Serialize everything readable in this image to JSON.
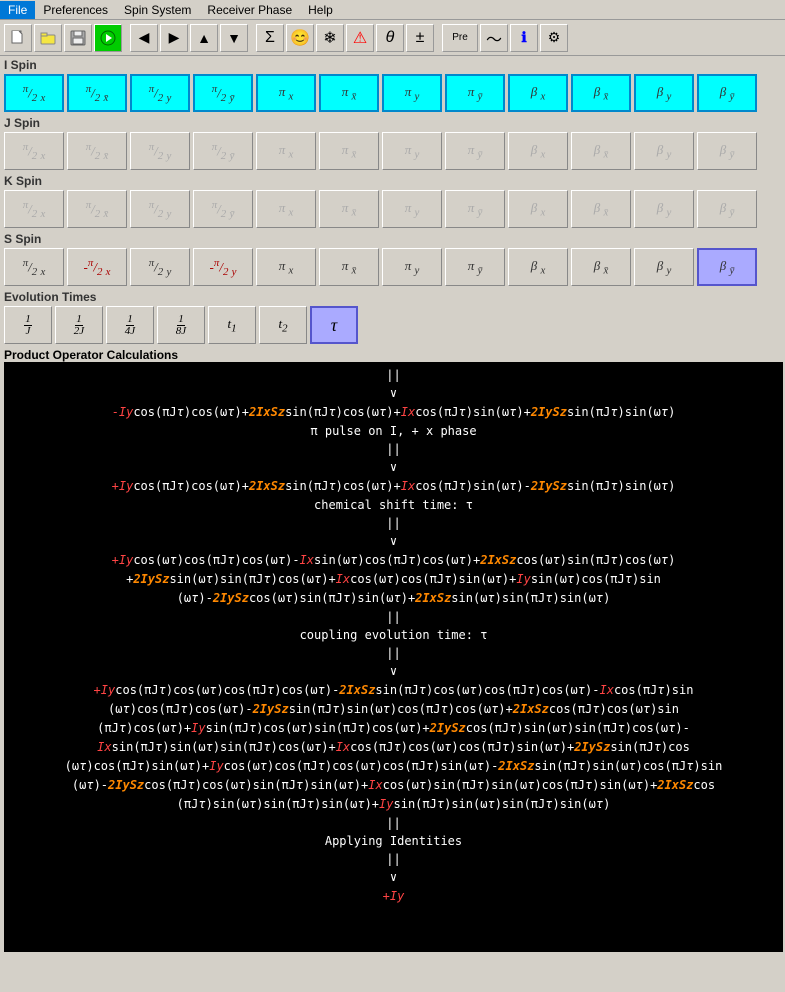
{
  "menubar": {
    "items": [
      "File",
      "Preferences",
      "Spin System",
      "Receiver Phase",
      "Help"
    ]
  },
  "toolbar": {
    "buttons": [
      {
        "name": "new",
        "icon": "📄"
      },
      {
        "name": "open",
        "icon": "📂"
      },
      {
        "name": "save",
        "icon": "💾"
      },
      {
        "name": "run",
        "icon": "▶"
      },
      {
        "name": "arrow-left",
        "icon": "◀"
      },
      {
        "name": "arrow-right",
        "icon": "▶"
      },
      {
        "name": "arrow-up",
        "icon": "▲"
      },
      {
        "name": "arrow-down",
        "icon": "▼"
      },
      {
        "name": "sigma",
        "icon": "Σ"
      },
      {
        "name": "face",
        "icon": "😊"
      },
      {
        "name": "snowflake",
        "icon": "❄"
      },
      {
        "name": "warning",
        "icon": "⚠"
      },
      {
        "name": "theta",
        "icon": "θ"
      },
      {
        "name": "plus-minus",
        "icon": "±"
      },
      {
        "name": "pre",
        "icon": "Pre"
      },
      {
        "name": "wave",
        "icon": "∿"
      },
      {
        "name": "info",
        "icon": "ℹ"
      },
      {
        "name": "settings",
        "icon": "⚙"
      }
    ]
  },
  "spins": {
    "i_spin": {
      "label": "I Spin",
      "buttons": [
        {
          "label": "π/2 x",
          "state": "cyan"
        },
        {
          "label": "π/2 x",
          "state": "cyan"
        },
        {
          "label": "π/2 y",
          "state": "cyan"
        },
        {
          "label": "π/2 y",
          "state": "cyan"
        },
        {
          "label": "π x",
          "state": "cyan"
        },
        {
          "label": "π x",
          "state": "cyan"
        },
        {
          "label": "π y",
          "state": "cyan"
        },
        {
          "label": "π y",
          "state": "cyan"
        },
        {
          "label": "β x",
          "state": "cyan"
        },
        {
          "label": "β x",
          "state": "cyan"
        },
        {
          "label": "β y",
          "state": "cyan"
        },
        {
          "label": "β y",
          "state": "cyan"
        }
      ]
    },
    "j_spin": {
      "label": "J Spin",
      "buttons": [
        {
          "label": "π/2 x",
          "state": "disabled"
        },
        {
          "label": "π/2 x",
          "state": "disabled"
        },
        {
          "label": "π/2 y",
          "state": "disabled"
        },
        {
          "label": "π/2 y",
          "state": "disabled"
        },
        {
          "label": "π x",
          "state": "disabled"
        },
        {
          "label": "π x",
          "state": "disabled"
        },
        {
          "label": "π y",
          "state": "disabled"
        },
        {
          "label": "π y",
          "state": "disabled"
        },
        {
          "label": "β x",
          "state": "disabled"
        },
        {
          "label": "β x",
          "state": "disabled"
        },
        {
          "label": "β y",
          "state": "disabled"
        },
        {
          "label": "β y",
          "state": "disabled"
        }
      ]
    },
    "k_spin": {
      "label": "K Spin",
      "buttons": [
        {
          "label": "π/2 x",
          "state": "disabled"
        },
        {
          "label": "π/2 x",
          "state": "disabled"
        },
        {
          "label": "π/2 y",
          "state": "disabled"
        },
        {
          "label": "π/2 y",
          "state": "disabled"
        },
        {
          "label": "π x",
          "state": "disabled"
        },
        {
          "label": "π x",
          "state": "disabled"
        },
        {
          "label": "π y",
          "state": "disabled"
        },
        {
          "label": "π y",
          "state": "disabled"
        },
        {
          "label": "β x",
          "state": "disabled"
        },
        {
          "label": "β x",
          "state": "disabled"
        },
        {
          "label": "β y",
          "state": "disabled"
        },
        {
          "label": "β y",
          "state": "disabled"
        }
      ]
    },
    "s_spin": {
      "label": "S Spin",
      "buttons": [
        {
          "label": "π/2 x",
          "state": "normal"
        },
        {
          "label": "π/2 x",
          "state": "normal"
        },
        {
          "label": "π/2 y",
          "state": "normal"
        },
        {
          "label": "π/2 y",
          "state": "normal"
        },
        {
          "label": "π x",
          "state": "normal"
        },
        {
          "label": "π x",
          "state": "normal"
        },
        {
          "label": "π y",
          "state": "normal"
        },
        {
          "label": "π y",
          "state": "normal"
        },
        {
          "label": "β x",
          "state": "normal"
        },
        {
          "label": "β x",
          "state": "normal"
        },
        {
          "label": "β y",
          "state": "normal"
        },
        {
          "label": "β y",
          "state": "normal"
        }
      ]
    }
  },
  "evolution": {
    "label": "Evolution Times",
    "buttons": [
      {
        "label": "1/J",
        "state": "normal"
      },
      {
        "label": "1/2J",
        "state": "normal"
      },
      {
        "label": "1/4J",
        "state": "normal"
      },
      {
        "label": "1/8J",
        "state": "normal"
      },
      {
        "label": "t1",
        "state": "normal"
      },
      {
        "label": "t2",
        "state": "normal"
      },
      {
        "label": "τ",
        "state": "active"
      }
    ]
  },
  "po_section": {
    "label": "Product Operator Calculations"
  }
}
